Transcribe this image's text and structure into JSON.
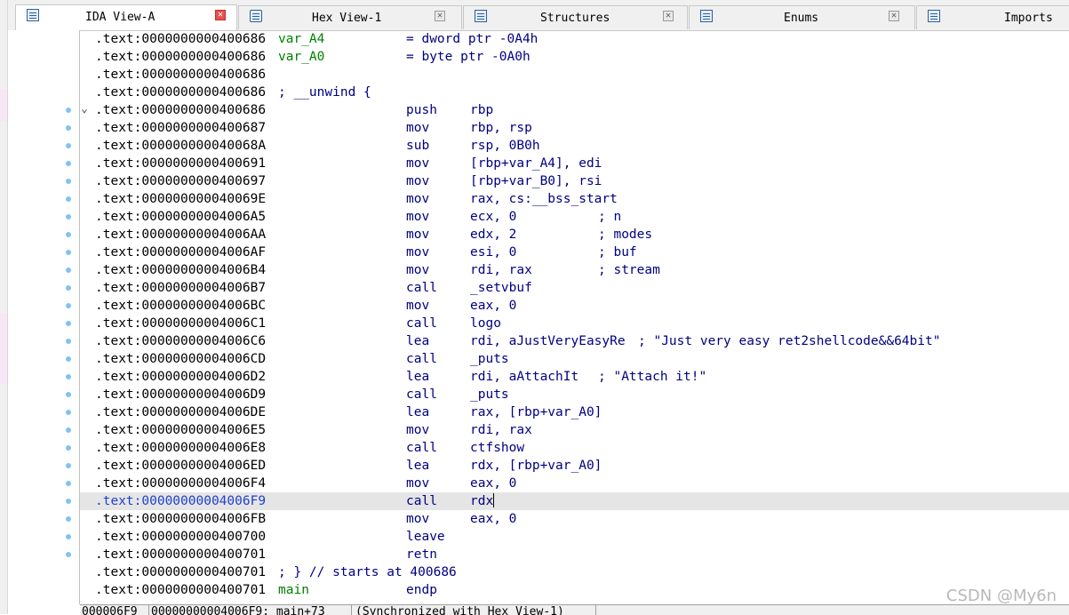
{
  "tabs": [
    {
      "label": "IDA View-A",
      "active": true
    },
    {
      "label": "Hex View-1",
      "active": false
    },
    {
      "label": "Structures",
      "active": false
    },
    {
      "label": "Enums",
      "active": false
    },
    {
      "label": "Imports",
      "active": false
    }
  ],
  "listing": [
    {
      "addr": ".text:0000000000400686",
      "label": "var_A4",
      "kind": "var",
      "rest": "= dword ptr -0A4h"
    },
    {
      "addr": ".text:0000000000400686",
      "label": "var_A0",
      "kind": "var",
      "rest": "= byte ptr -0A0h"
    },
    {
      "addr": ".text:0000000000400686"
    },
    {
      "addr": ".text:0000000000400686",
      "label": "; __unwind {",
      "kind": "comment"
    },
    {
      "addr": ".text:0000000000400686",
      "mnemonic": "push",
      "operand": "rbp",
      "collapsible": true
    },
    {
      "addr": ".text:0000000000400687",
      "mnemonic": "mov",
      "operand": "rbp, rsp"
    },
    {
      "addr": ".text:000000000040068A",
      "mnemonic": "sub",
      "operand": "rsp, 0B0h"
    },
    {
      "addr": ".text:0000000000400691",
      "mnemonic": "mov",
      "operand": "[rbp+var_A4], edi"
    },
    {
      "addr": ".text:0000000000400697",
      "mnemonic": "mov",
      "operand": "[rbp+var_B0], rsi"
    },
    {
      "addr": ".text:000000000040069E",
      "mnemonic": "mov",
      "operand": "rax, cs:__bss_start"
    },
    {
      "addr": ".text:00000000004006A5",
      "mnemonic": "mov",
      "operand": "ecx, 0",
      "comment": "; n"
    },
    {
      "addr": ".text:00000000004006AA",
      "mnemonic": "mov",
      "operand": "edx, 2",
      "comment": "; modes"
    },
    {
      "addr": ".text:00000000004006AF",
      "mnemonic": "mov",
      "operand": "esi, 0",
      "comment": "; buf"
    },
    {
      "addr": ".text:00000000004006B4",
      "mnemonic": "mov",
      "operand": "rdi, rax",
      "comment": "; stream"
    },
    {
      "addr": ".text:00000000004006B7",
      "mnemonic": "call",
      "operand": "_setvbuf"
    },
    {
      "addr": ".text:00000000004006BC",
      "mnemonic": "mov",
      "operand": "eax, 0"
    },
    {
      "addr": ".text:00000000004006C1",
      "mnemonic": "call",
      "operand": "logo"
    },
    {
      "addr": ".text:00000000004006C6",
      "mnemonic": "lea",
      "operand": "rdi, aJustVeryEasyRe",
      "comment": "; \"Just very easy ret2shellcode&&64bit\""
    },
    {
      "addr": ".text:00000000004006CD",
      "mnemonic": "call",
      "operand": "_puts"
    },
    {
      "addr": ".text:00000000004006D2",
      "mnemonic": "lea",
      "operand": "rdi, aAttachIt",
      "comment": "; \"Attach it!\""
    },
    {
      "addr": ".text:00000000004006D9",
      "mnemonic": "call",
      "operand": "_puts"
    },
    {
      "addr": ".text:00000000004006DE",
      "mnemonic": "lea",
      "operand": "rax, [rbp+var_A0]"
    },
    {
      "addr": ".text:00000000004006E5",
      "mnemonic": "mov",
      "operand": "rdi, rax"
    },
    {
      "addr": ".text:00000000004006E8",
      "mnemonic": "call",
      "operand": "ctfshow"
    },
    {
      "addr": ".text:00000000004006ED",
      "mnemonic": "lea",
      "operand": "rdx, [rbp+var_A0]"
    },
    {
      "addr": ".text:00000000004006F4",
      "mnemonic": "mov",
      "operand": "eax, 0"
    },
    {
      "addr": ".text:00000000004006F9",
      "mnemonic": "call",
      "operand": "rdx",
      "highlighted": true
    },
    {
      "addr": ".text:00000000004006FB",
      "mnemonic": "mov",
      "operand": "eax, 0"
    },
    {
      "addr": ".text:0000000000400700",
      "mnemonic": "leave"
    },
    {
      "addr": ".text:0000000000400701",
      "mnemonic": "retn"
    },
    {
      "addr": ".text:0000000000400701",
      "label": "; } // starts at 400686",
      "kind": "comment"
    },
    {
      "addr": ".text:0000000000400701",
      "label": "main",
      "kind": "func",
      "mnemonic": "endp"
    }
  ],
  "status": {
    "offset": "000006F9",
    "location": "00000000004006F9: main+73",
    "sync": "(Synchronized with Hex View-1)"
  },
  "watermark": "CSDN @My6n",
  "colors": {
    "label_green": "#008000",
    "code_blue": "#000080",
    "highlight_row": "#e5e5e5",
    "gutter_dot": "#7fc4f0",
    "active_close": "#e85050"
  }
}
